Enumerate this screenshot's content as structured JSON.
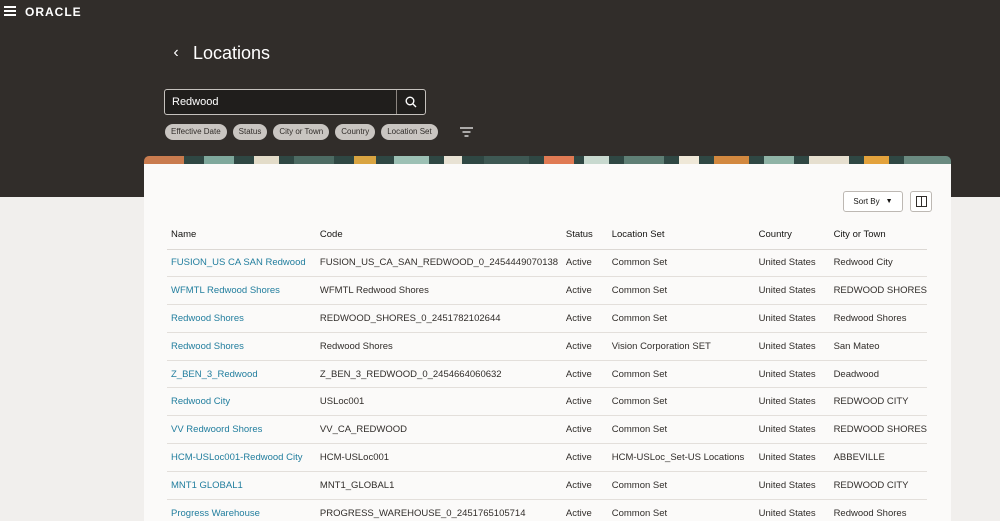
{
  "brand": {
    "logo_text": "ORACLE"
  },
  "header": {
    "title": "Locations"
  },
  "search": {
    "value": "Redwood"
  },
  "filters": [
    "Effective Date",
    "Status",
    "City or Town",
    "Country",
    "Location Set"
  ],
  "toolbar": {
    "sort_label": "Sort By"
  },
  "table": {
    "columns": [
      "Name",
      "Code",
      "Status",
      "Location Set",
      "Country",
      "City or Town"
    ],
    "rows": [
      [
        "FUSION_US CA SAN Redwood",
        "FUSION_US_CA_SAN_REDWOOD_0_2454449070138",
        "Active",
        "Common Set",
        "United States",
        "Redwood City"
      ],
      [
        "WFMTL Redwood Shores",
        "WFMTL Redwood Shores",
        "Active",
        "Common Set",
        "United States",
        "REDWOOD SHORES"
      ],
      [
        "Redwood Shores",
        "REDWOOD_SHORES_0_2451782102644",
        "Active",
        "Common Set",
        "United States",
        "Redwood Shores"
      ],
      [
        "Redwood Shores",
        "Redwood Shores",
        "Active",
        "Vision Corporation SET",
        "United States",
        "San Mateo"
      ],
      [
        "Z_BEN_3_Redwood",
        "Z_BEN_3_REDWOOD_0_2454664060632",
        "Active",
        "Common Set",
        "United States",
        "Deadwood"
      ],
      [
        "Redwood City",
        "USLoc001",
        "Active",
        "Common Set",
        "United States",
        "REDWOOD CITY"
      ],
      [
        "VV Redwoord Shores",
        "VV_CA_REDWOOD",
        "Active",
        "Common Set",
        "United States",
        "REDWOOD SHORES"
      ],
      [
        "HCM-USLoc001-Redwood City",
        "HCM-USLoc001",
        "Active",
        "HCM-USLoc_Set-US Locations",
        "United States",
        "ABBEVILLE"
      ],
      [
        "MNT1 GLOBAL1",
        "MNT1_GLOBAL1",
        "Active",
        "Common Set",
        "United States",
        "REDWOOD CITY"
      ],
      [
        "Progress Warehouse",
        "PROGRESS_WAREHOUSE_0_2451765105714",
        "Active",
        "Common Set",
        "United States",
        "Redwood Shores"
      ]
    ]
  },
  "colors": {
    "header_bg": "#312d2a",
    "link": "#227e9e",
    "page_bg": "#f1efed"
  }
}
